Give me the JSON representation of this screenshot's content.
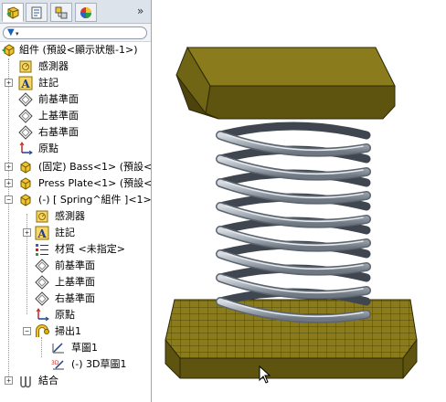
{
  "tabs": {
    "items": [
      {
        "name": "feature-manager"
      },
      {
        "name": "property-manager"
      },
      {
        "name": "configuration-manager"
      },
      {
        "name": "display-manager"
      }
    ],
    "more": "»"
  },
  "filter": {
    "icon": "filter-icon"
  },
  "tree": {
    "root": "組件 (預設<顯示狀態-1>)",
    "sensors": "感測器",
    "annotations": "註記",
    "front_plane": "前基準面",
    "top_plane": "上基準面",
    "right_plane": "右基準面",
    "origin": "原點",
    "comp_bass": "(固定) Bass<1> (預設<",
    "comp_press": "Press Plate<1> (預設<",
    "comp_spring": "(-) [ Spring^組件 ]<1>",
    "spring": {
      "sensors": "感測器",
      "annotations": "註記",
      "material": "材質 <未指定>",
      "front_plane": "前基準面",
      "top_plane": "上基準面",
      "right_plane": "右基準面",
      "origin": "原點",
      "sweep": "掃出1",
      "sketch": "草圖1",
      "sketch3d": "(-) 3D草圖1"
    },
    "mates": "結合"
  },
  "colors": {
    "plate_top": "#8a7c1c",
    "plate_side": "#5e540f",
    "coil": "#a8afb8",
    "panel_tab_bg": "#dce3eb"
  }
}
